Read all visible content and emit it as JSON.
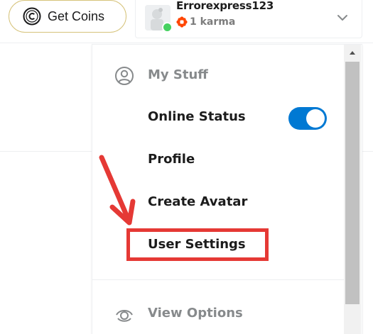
{
  "header": {
    "get_coins_label": "Get Coins",
    "username": "Errorexpress123",
    "karma": "1 karma",
    "online_color": "#46d160",
    "icons": {
      "coin": "coin-icon",
      "karma": "karma-flower-icon",
      "chevron": "chevron-down-icon"
    }
  },
  "menu": {
    "section_my_stuff": "My Stuff",
    "items": [
      {
        "label": "Online Status",
        "toggle_on": true
      },
      {
        "label": "Profile"
      },
      {
        "label": "Create Avatar"
      },
      {
        "label": "User Settings"
      }
    ],
    "section_view_options": "View Options",
    "accent_color": "#0079d3"
  },
  "annotation": {
    "highlight_color": "#e53935",
    "highlighted_item": "User Settings"
  }
}
